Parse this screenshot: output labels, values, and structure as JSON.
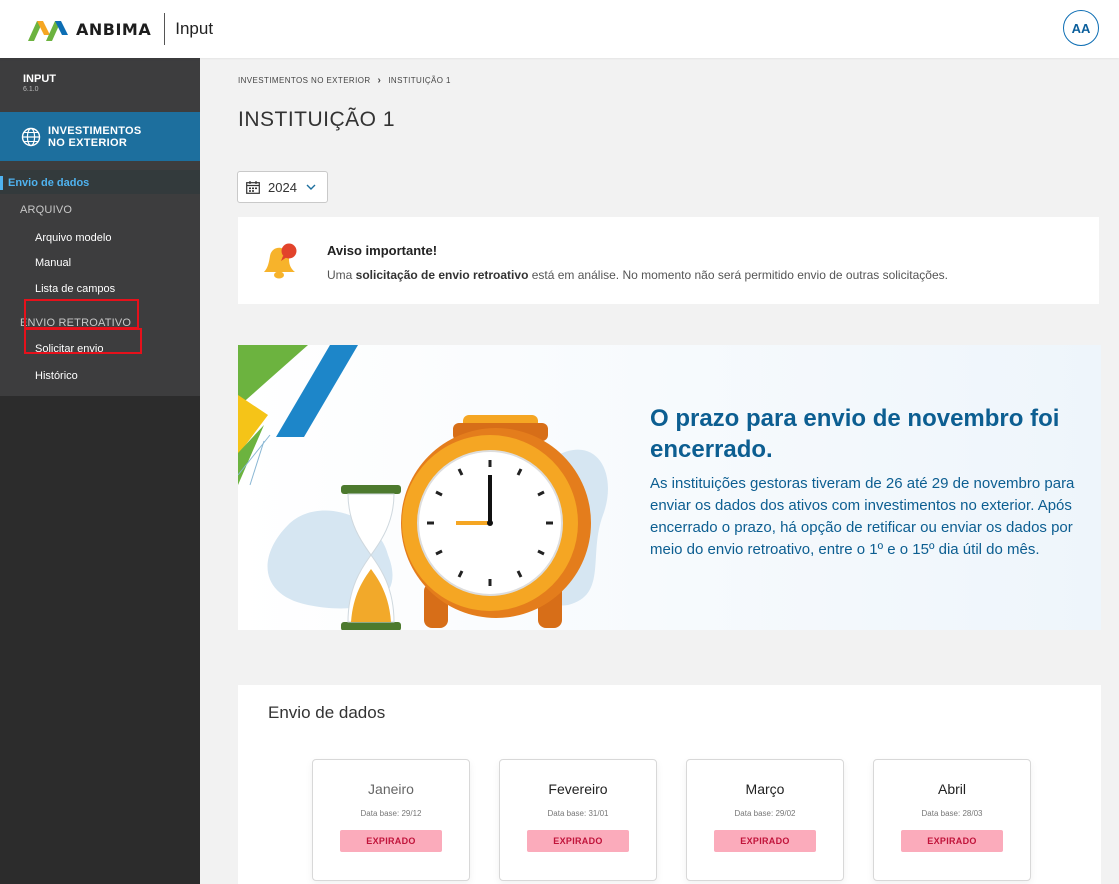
{
  "header": {
    "brand": "ANBIMA",
    "app": "Input",
    "avatar_initials": "AA",
    "brand_colors": [
      "#6cb33f",
      "#f5a623",
      "#0d6eb4"
    ]
  },
  "sidebar": {
    "app_name": "INPUT",
    "version": "6.1.0",
    "module_label": "INVESTIMENTOS\nNO EXTERIOR",
    "active_item": "Envio de dados",
    "sections": [
      {
        "label": "ARQUIVO",
        "items": [
          "Arquivo modelo",
          "Manual",
          "Lista de campos"
        ]
      },
      {
        "label": "ENVIO RETROATIVO",
        "items": [
          "Solicitar envio",
          "Histórico"
        ]
      }
    ],
    "accent_color": "#4fb3f0"
  },
  "breadcrumb": [
    "INVESTIMENTOS NO EXTERIOR",
    "INSTITUIÇÃO 1"
  ],
  "page_title": "INSTITUIÇÃO 1",
  "year_select": {
    "value": "2024"
  },
  "notice": {
    "title": "Aviso importante!",
    "text_before": "Uma ",
    "text_bold": "solicitação de envio retroativo",
    "text_after": " está em análise. No momento não será permitido envio de outras solicitações."
  },
  "banner": {
    "headline": "O prazo para envio de novembro foi encerrado.",
    "body": "As instituições gestoras tiveram de 26 até 29 de novembro para enviar os dados dos ativos com investimentos no exterior. Após encerrado o prazo, há opção de retificar ou enviar os dados por meio do envio retroativo, entre o 1º e o 15º dia útil do mês.",
    "text_color": "#0c5e91"
  },
  "months_panel": {
    "title": "Envio de dados",
    "months": [
      {
        "name": "Janeiro",
        "base": "Data base: 29/12",
        "status": "EXPIRADO"
      },
      {
        "name": "Fevereiro",
        "base": "Data base: 31/01",
        "status": "EXPIRADO"
      },
      {
        "name": "Março",
        "base": "Data base: 29/02",
        "status": "EXPIRADO"
      },
      {
        "name": "Abril",
        "base": "Data base: 28/03",
        "status": "EXPIRADO"
      }
    ],
    "status_color": "#fbabbb"
  }
}
